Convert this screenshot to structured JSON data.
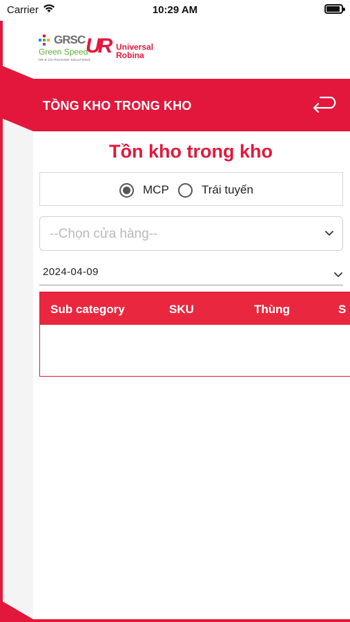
{
  "status_bar": {
    "carrier": "Carrier",
    "time": "10:29 AM"
  },
  "logo": {
    "grsc": "GRSC",
    "green_speed": "Green Speed",
    "tagline": "HR & CO-PACKING SOLUTIONS",
    "ur_mark": "UR",
    "ur_line1": "Universal",
    "ur_line2": "Robina"
  },
  "header": {
    "title": "TỒNG KHO TRONG KHO"
  },
  "page": {
    "title": "Tồn kho trong kho"
  },
  "radio_group": {
    "options": [
      {
        "label": "MCP",
        "checked": true
      },
      {
        "label": "Trái tuyến",
        "checked": false
      }
    ]
  },
  "store_select": {
    "placeholder": "--Chọn cửa hàng--"
  },
  "date_field": {
    "value": "2024-04-09"
  },
  "table": {
    "columns": [
      "Sub category",
      "SKU",
      "Thùng",
      "S"
    ]
  },
  "colors": {
    "accent": "#e3173b",
    "table_header": "#e9283f",
    "green": "#5ab030"
  },
  "icons": {
    "back": "return-arrow-icon",
    "select": "chevron-down-icon",
    "wifi": "wifi-icon",
    "battery": "battery-icon"
  }
}
